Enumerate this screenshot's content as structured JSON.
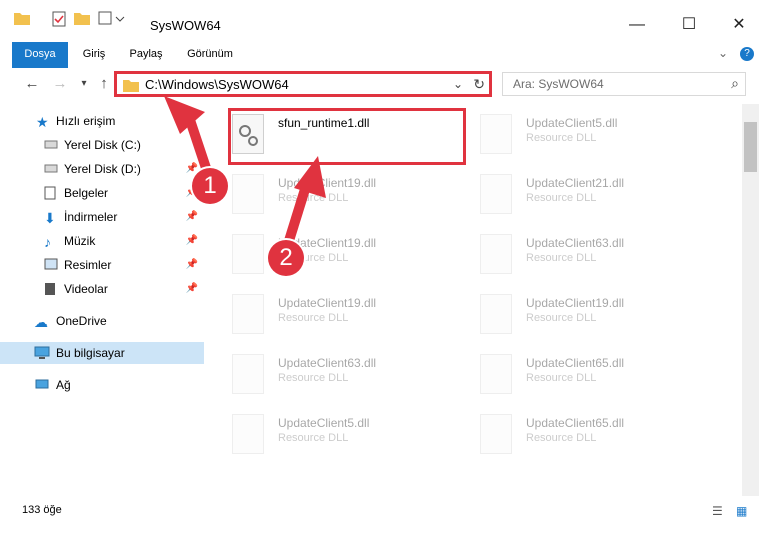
{
  "window": {
    "title": "SysWOW64"
  },
  "ribbon": {
    "tabs": [
      "Dosya",
      "Giriş",
      "Paylaş",
      "Görünüm"
    ]
  },
  "address": {
    "path": "C:\\Windows\\SysWOW64"
  },
  "search": {
    "placeholder": "Ara: SysWOW64"
  },
  "sidebar": {
    "items": [
      {
        "label": "Hızlı erişim",
        "icon": "star-icon"
      },
      {
        "label": "Yerel Disk (C:)",
        "icon": "drive-icon"
      },
      {
        "label": "Yerel Disk (D:)",
        "icon": "drive-icon"
      },
      {
        "label": "Belgeler",
        "icon": "document-icon"
      },
      {
        "label": "İndirmeler",
        "icon": "download-icon"
      },
      {
        "label": "Müzik",
        "icon": "music-icon"
      },
      {
        "label": "Resimler",
        "icon": "pictures-icon"
      },
      {
        "label": "Videolar",
        "icon": "video-icon"
      },
      {
        "label": "OneDrive",
        "icon": "cloud-icon"
      },
      {
        "label": "Bu bilgisayar",
        "icon": "computer-icon"
      },
      {
        "label": "Ağ",
        "icon": "network-icon"
      }
    ]
  },
  "files": [
    {
      "name": "sfun_runtime1.dll",
      "type": "",
      "faded": false
    },
    {
      "name": "UpdateClient5.dll",
      "type": "Resource DLL",
      "faded": true
    },
    {
      "name": "UpdateClient19.dll",
      "type": "Resource DLL",
      "faded": true
    },
    {
      "name": "UpdateClient21.dll",
      "type": "Resource DLL",
      "faded": true
    },
    {
      "name": "UpdateClient19.dll",
      "type": "Resource DLL",
      "faded": true
    },
    {
      "name": "UpdateClient63.dll",
      "type": "Resource DLL",
      "faded": true
    },
    {
      "name": "UpdateClient19.dll",
      "type": "Resource DLL",
      "faded": true
    },
    {
      "name": "UpdateClient19.dll",
      "type": "Resource DLL",
      "faded": true
    },
    {
      "name": "UpdateClient63.dll",
      "type": "Resource DLL",
      "faded": true
    },
    {
      "name": "UpdateClient65.dll",
      "type": "Resource DLL",
      "faded": true
    },
    {
      "name": "UpdateClient5.dll",
      "type": "Resource DLL",
      "faded": true
    },
    {
      "name": "UpdateClient65.dll",
      "type": "Resource DLL",
      "faded": true
    }
  ],
  "status": {
    "count": "133 öğe"
  },
  "annotations": [
    "1",
    "2"
  ],
  "colors": {
    "accent": "#1979ca",
    "highlight": "#e0333f"
  }
}
